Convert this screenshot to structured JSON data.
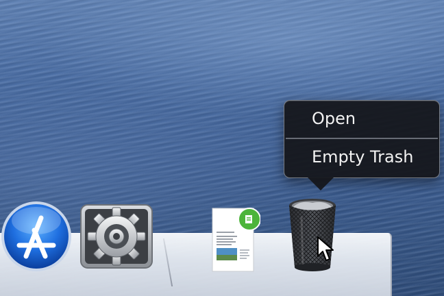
{
  "context_menu": {
    "items": [
      {
        "label": "Open"
      },
      {
        "label": "Empty Trash"
      }
    ]
  },
  "dock": {
    "items": [
      {
        "name": "App Store",
        "icon": "app-store-icon"
      },
      {
        "name": "System Preferences",
        "icon": "gear-icon"
      },
      {
        "name": "Document",
        "icon": "document-icon"
      },
      {
        "name": "Trash",
        "icon": "trash-icon"
      }
    ]
  },
  "colors": {
    "menu_background": "#16181c",
    "menu_text": "#f2f2f2",
    "app_store_blue": "#1f6fe0",
    "dock_shelf": "#e4e9f0"
  }
}
